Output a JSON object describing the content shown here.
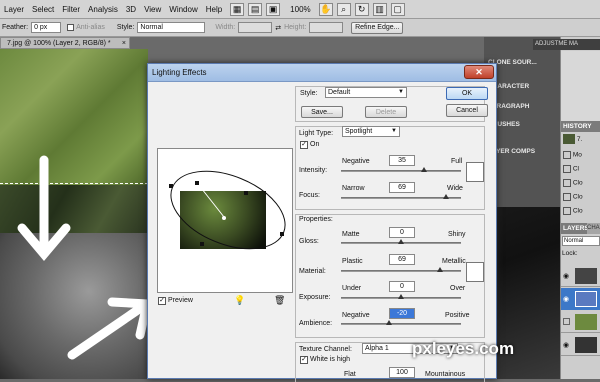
{
  "menubar": {
    "items": [
      "Layer",
      "Select",
      "Filter",
      "Analysis",
      "3D",
      "View",
      "Window",
      "Help"
    ],
    "zoom": "100%"
  },
  "options": {
    "feather_label": "Feather:",
    "feather_value": "0 px",
    "antialias_label": "Anti-alias",
    "style_label": "Style:",
    "style_value": "Normal",
    "width_label": "Width:",
    "height_label": "Height:",
    "refine_edge": "Refine Edge..."
  },
  "doc_tab": {
    "title": "7.jpg @ 100% (Layer 2, RGB/8) *"
  },
  "panels": {
    "top_tab": "ADJUSTME MA",
    "items": [
      "CLONE SOUR...",
      "CHARACTER",
      "PARAGRAPH",
      "BRUSHES",
      "LAYER COMPS"
    ],
    "history_title": "HISTORY",
    "history_items": [
      "7.",
      "Mo",
      "Cl",
      "Clo",
      "Clo",
      "Clo"
    ],
    "layers_title": "LAYERS",
    "layers_tab2": "CHA",
    "blend_mode": "Normal",
    "lock_label": "Lock:"
  },
  "dialog": {
    "title": "Lighting Effects",
    "style_label": "Style:",
    "style_value": "Default",
    "save": "Save...",
    "delete": "Delete",
    "ok": "OK",
    "cancel": "Cancel",
    "light_type_label": "Light Type:",
    "light_type_value": "Spotlight",
    "on_label": "On",
    "intensity": {
      "label": "Intensity:",
      "left": "Negative",
      "right": "Full",
      "value": "35"
    },
    "focus": {
      "label": "Focus:",
      "left": "Narrow",
      "right": "Wide",
      "value": "69"
    },
    "properties_label": "Properties:",
    "gloss": {
      "label": "Gloss:",
      "left": "Matte",
      "right": "Shiny",
      "value": "0"
    },
    "material": {
      "label": "Material:",
      "left": "Plastic",
      "right": "Metallic",
      "value": "69"
    },
    "exposure": {
      "label": "Exposure:",
      "left": "Under",
      "right": "Over",
      "value": "0"
    },
    "ambience": {
      "label": "Ambience:",
      "left": "Negative",
      "right": "Positive",
      "value": "-20"
    },
    "texture_label": "Texture Channel:",
    "texture_value": "Alpha 1",
    "white_high": "White is high",
    "height_left": "Flat",
    "height_right": "Mountainous",
    "height_value": "100",
    "preview_label": "Preview"
  },
  "watermark": "pxleyes.com"
}
